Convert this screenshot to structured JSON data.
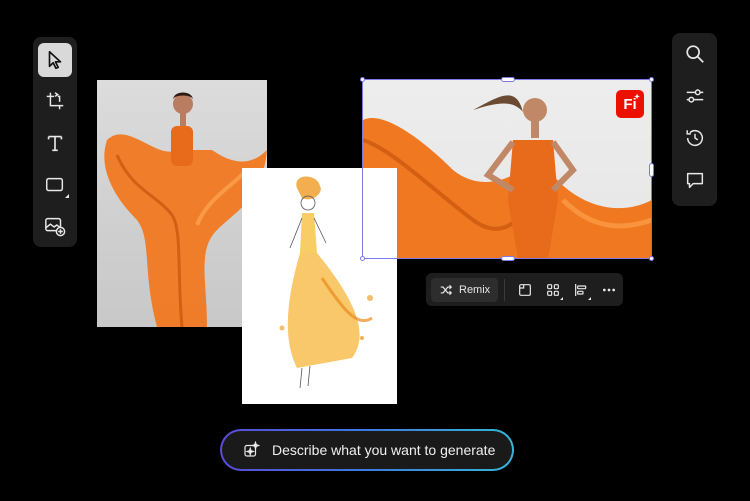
{
  "left_toolbar": {
    "tools": [
      {
        "name": "select-arrow-icon",
        "active": true
      },
      {
        "name": "crop-icon"
      },
      {
        "name": "text-icon"
      },
      {
        "name": "rectangle-shape-icon"
      },
      {
        "name": "add-image-icon"
      }
    ]
  },
  "right_toolbar": {
    "tools": [
      {
        "name": "search-icon"
      },
      {
        "name": "sliders-icon"
      },
      {
        "name": "history-icon"
      },
      {
        "name": "comment-icon"
      }
    ]
  },
  "canvas": {
    "badge_text": "Fi",
    "selection_color": "#7b79e8",
    "accent_orange": "#f07820"
  },
  "context_bar": {
    "remix_label": "Remix",
    "icons": [
      "frame-icon",
      "grid-variations-icon",
      "align-icon",
      "more-icon"
    ]
  },
  "prompt": {
    "text": "Describe what you want to generate",
    "gradient": [
      "#5a4bd6",
      "#3c7be0",
      "#36b6d6"
    ]
  }
}
